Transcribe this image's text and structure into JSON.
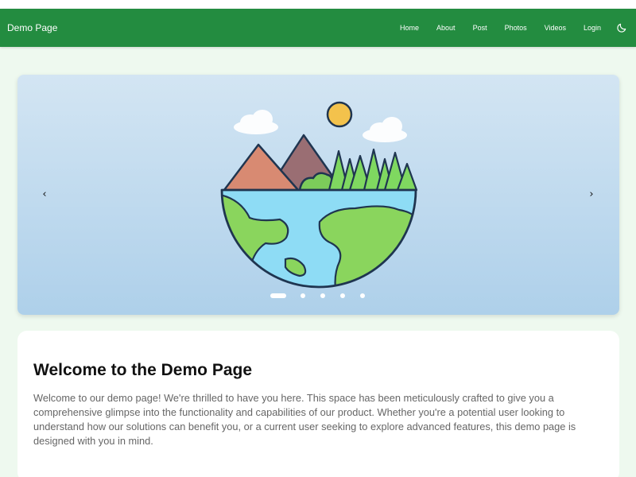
{
  "navbar": {
    "brand": "Demo Page",
    "links": [
      "Home",
      "About",
      "Post",
      "Photos",
      "Videos",
      "Login"
    ],
    "theme_icon": "moon-icon",
    "background": "#238c40"
  },
  "carousel": {
    "illustration": "earth-hemisphere-with-mountains-and-trees",
    "prev_icon": "chevron-left-icon",
    "next_icon": "chevron-right-icon",
    "slide_count": 5,
    "active_slide": 1
  },
  "welcome": {
    "title": "Welcome to the Demo Page",
    "text": "Welcome to our demo page! We're thrilled to have you here. This space has been meticulously crafted to give you a comprehensive glimpse into the functionality and capabilities of our product. Whether you're a potential user looking to understand how our solutions can benefit you, or a current user seeking to explore advanced features, this demo page is designed with you in mind."
  }
}
